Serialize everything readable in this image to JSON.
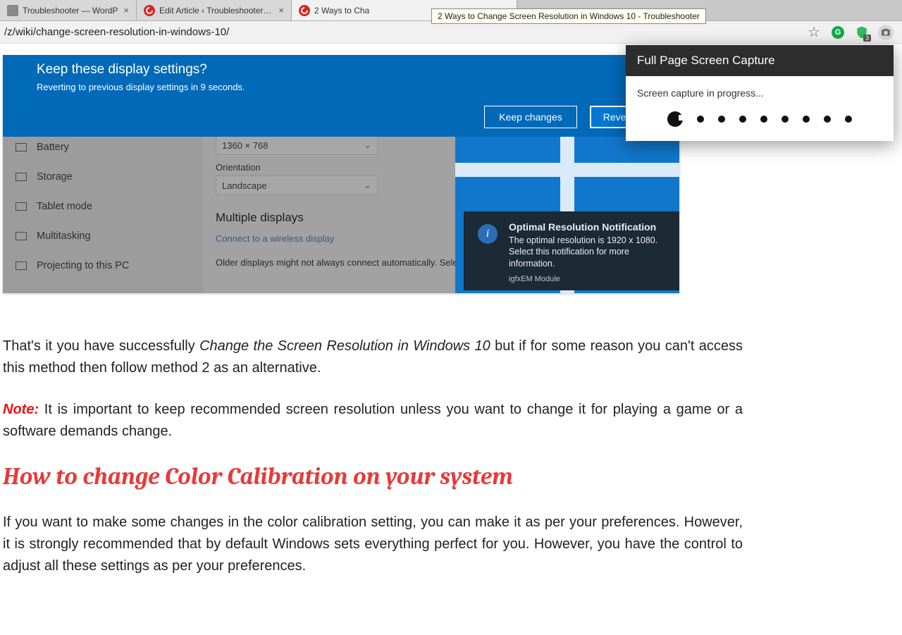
{
  "tabs": [
    {
      "title": "Troubleshooter — WordP",
      "active": false,
      "favicon": "generic"
    },
    {
      "title": "Edit Article ‹ Troubleshooter — W",
      "active": false,
      "favicon": "red"
    },
    {
      "title": "2 Ways to Cha",
      "active": true,
      "favicon": "red"
    }
  ],
  "tab_tooltip": "2 Ways to Change Screen Resolution in Windows 10 - Troubleshooter",
  "address_bar": {
    "url": "/z/wiki/change-screen-resolution-in-windows-10/"
  },
  "toolbar_icons": {
    "star": "☆",
    "grammarly": "G",
    "shield_badge": "3"
  },
  "windows_screenshot": {
    "banner": {
      "title": "Keep these display settings?",
      "subtitle": "Reverting to previous display settings in  9 seconds.",
      "btn_keep": "Keep changes",
      "btn_revert": "Revert"
    },
    "fields": {
      "resolution_value": "1360 × 768",
      "orientation_label": "Orientation",
      "orientation_value": "Landscape"
    },
    "multi": {
      "heading": "Multiple displays",
      "link": "Connect to a wireless display",
      "note": "Older displays might not always connect automatically. Select Detect to try to connect to them."
    },
    "sidebar_items": [
      "Battery",
      "Storage",
      "Tablet mode",
      "Multitasking",
      "Projecting to this PC"
    ],
    "toast": {
      "title": "Optimal Resolution Notification",
      "body": "The optimal resolution is 1920 x 1080. Select this notification for more information.",
      "source": "igfxEM Module",
      "icon": "i"
    }
  },
  "extension_popup": {
    "title": "Full Page Screen Capture",
    "status": "Screen capture in progress..."
  },
  "article": {
    "p1_a": "That's it you have successfully ",
    "p1_b": "Change the Screen Resolution in Windows 10",
    "p1_c": " but if for some reason you can't access this method then follow method 2 as an alternative.",
    "note_label": "Note:",
    "p2": " It is important to keep recommended screen resolution unless you want to change it for playing a game or a software demands change.",
    "h2": "How to change Color Calibration on your system",
    "p3": "If you want to make some changes in the color calibration setting, you can make it as per your preferences. However, it is strongly recommended that by default Windows sets everything perfect for you. However, you have the control to adjust all these settings as per your preferences."
  }
}
